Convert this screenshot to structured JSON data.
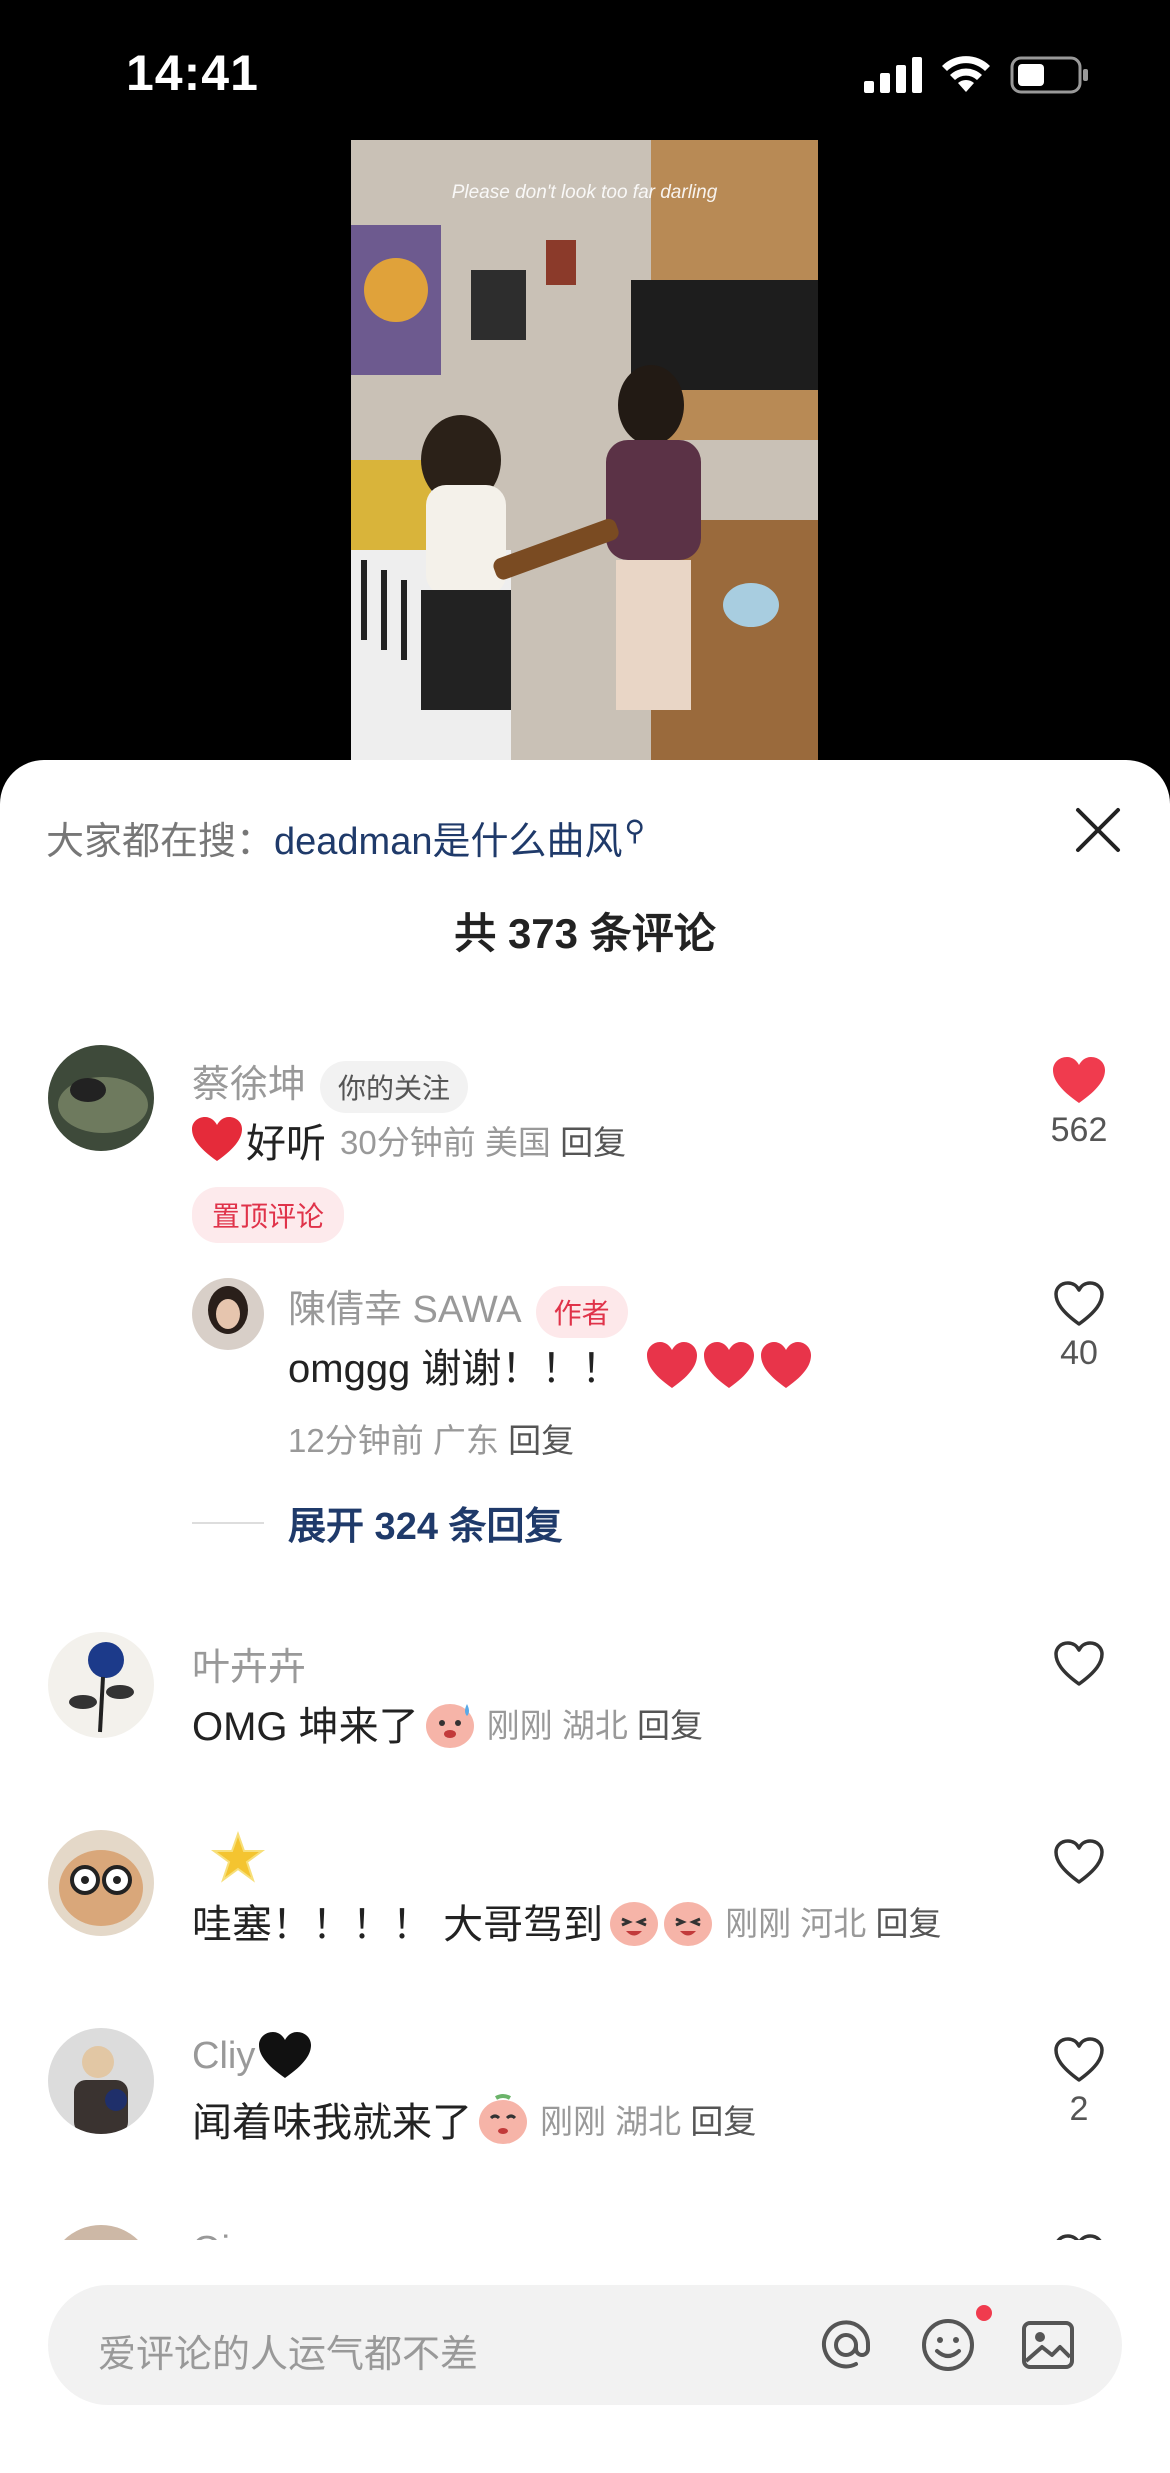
{
  "status": {
    "time": "14:41"
  },
  "video": {
    "caption": "Please don't look too far darling"
  },
  "search": {
    "prefix": "大家都在搜：",
    "term": "deadman是什么曲风"
  },
  "comments_header": {
    "title": "共 373 条评论"
  },
  "comments": [
    {
      "name": "蔡徐坤",
      "tag": "你的关注",
      "text": "好听",
      "time": "30分钟前",
      "location": "美国",
      "reply": "回复",
      "pinned": "置顶评论",
      "likes": "562",
      "liked": true
    },
    {
      "name": "叶卉卉",
      "text": "OMG 坤来了",
      "time": "刚刚",
      "location": "湖北",
      "reply": "回复"
    },
    {
      "text": "哇塞！！！！ 大哥驾到",
      "time": "刚刚",
      "location": "河北",
      "reply": "回复"
    },
    {
      "name": "Cliy",
      "text": "闻着味我就来了",
      "time": "刚刚",
      "location": "湖北",
      "reply": "回复",
      "likes": "2"
    },
    {
      "name": "Qing"
    }
  ],
  "reply_thread": {
    "name": "陳倩幸 SAWA",
    "tag": "作者",
    "text": "omggg 谢谢！！！",
    "time": "12分钟前",
    "location": "广东",
    "reply": "回复",
    "likes": "40",
    "expand": "展开 324 条回复"
  },
  "input": {
    "placeholder": "爱评论的人运气都不差"
  },
  "colors": {
    "accent": "#f03b4e",
    "link": "#1f3a6a"
  }
}
